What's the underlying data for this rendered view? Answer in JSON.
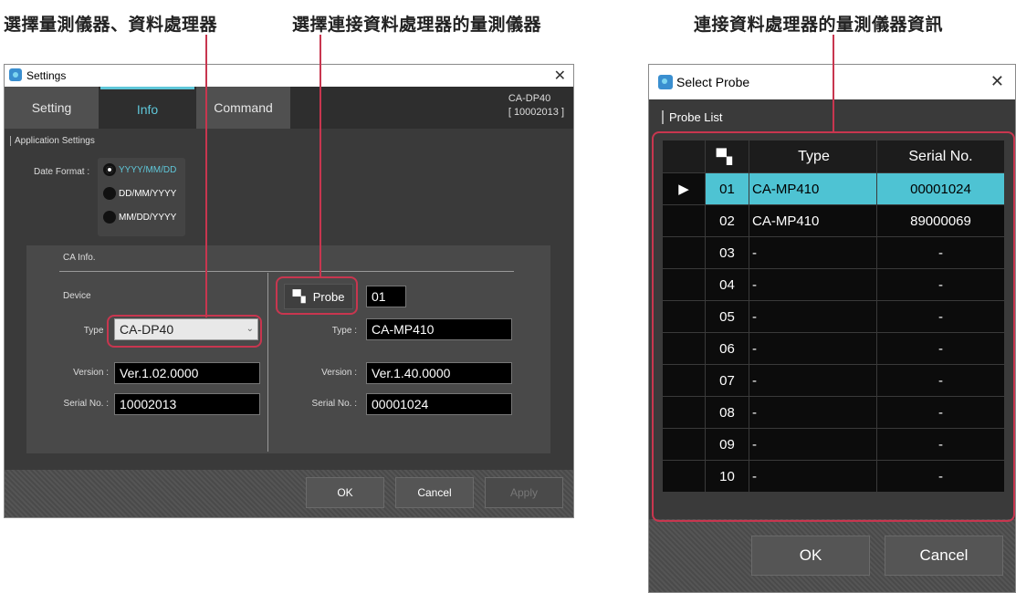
{
  "captions": {
    "left": "選擇量測儀器、資料處理器",
    "middle": "選擇連接資料處理器的量測儀器",
    "right": "連接資料處理器的量測儀器資訊"
  },
  "colors": {
    "accent": "#5fc7d9",
    "callout": "#c8364f",
    "selected_row": "#4ec3d3"
  },
  "settings": {
    "title": "Settings",
    "tabs": [
      "Setting",
      "Info",
      "Command"
    ],
    "active_tab": "Info",
    "device_label": "CA-DP40",
    "device_serial": "[ 10002013 ]",
    "app_settings_label": "Application Settings",
    "date_format_label": "Date Format :",
    "date_formats": [
      "YYYY/MM/DD",
      "DD/MM/YYYY",
      "MM/DD/YYYY"
    ],
    "selected_date_format": "YYYY/MM/DD",
    "ca_info_label": "CA Info.",
    "device_section_label": "Device",
    "type_label": "Type :",
    "version_label": "Version :",
    "serial_label": "Serial No. :",
    "device_type": "CA-DP40",
    "device_version": "Ver.1.02.0000",
    "device_serial_no": "10002013",
    "probe_button": "Probe",
    "probe_number": "01",
    "probe_type": "CA-MP410",
    "probe_version": "Ver.1.40.0000",
    "probe_serial_no": "00001024",
    "ok": "OK",
    "cancel": "Cancel",
    "apply": "Apply"
  },
  "probe_window": {
    "title": "Select Probe",
    "list_label": "Probe List",
    "headers": [
      "",
      "Type",
      "Serial No."
    ],
    "rows": [
      {
        "no": "01",
        "type": "CA-MP410",
        "serial": "00001024",
        "selected": true
      },
      {
        "no": "02",
        "type": "CA-MP410",
        "serial": "89000069",
        "selected": false
      },
      {
        "no": "03",
        "type": "-",
        "serial": "-",
        "selected": false
      },
      {
        "no": "04",
        "type": "-",
        "serial": "-",
        "selected": false
      },
      {
        "no": "05",
        "type": "-",
        "serial": "-",
        "selected": false
      },
      {
        "no": "06",
        "type": "-",
        "serial": "-",
        "selected": false
      },
      {
        "no": "07",
        "type": "-",
        "serial": "-",
        "selected": false
      },
      {
        "no": "08",
        "type": "-",
        "serial": "-",
        "selected": false
      },
      {
        "no": "09",
        "type": "-",
        "serial": "-",
        "selected": false
      },
      {
        "no": "10",
        "type": "-",
        "serial": "-",
        "selected": false
      }
    ],
    "ok": "OK",
    "cancel": "Cancel"
  }
}
